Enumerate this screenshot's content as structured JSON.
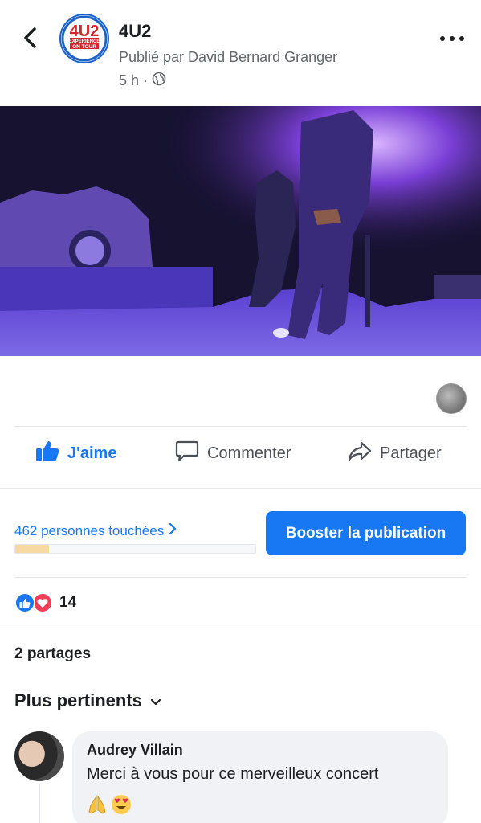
{
  "post": {
    "page_name": "4U2",
    "published_by": "Publié par David Bernard Granger",
    "time": "5 h",
    "separator": "·",
    "avatar_text": {
      "top": "4U2",
      "line1": "EXPERIENCE",
      "line2": "ON TOUR"
    }
  },
  "actions": {
    "like_label": "J'aime",
    "comment_label": "Commenter",
    "share_label": "Partager"
  },
  "reach": {
    "people_reached": "462 personnes touchées",
    "progress_fraction": 0.14,
    "boost_label": "Booster la publication"
  },
  "reactions": {
    "count": "14"
  },
  "shares": "2 partages",
  "sort": {
    "label": "Plus pertinents"
  },
  "comments": [
    {
      "author": "Audrey Villain",
      "text": "Merci à vous pour ce merveilleux concert",
      "emoji": [
        "🙏",
        "😍"
      ]
    }
  ],
  "colors": {
    "accent": "#1877f2",
    "love": "#f33e58",
    "progress_fill": "#f7d9a2"
  }
}
